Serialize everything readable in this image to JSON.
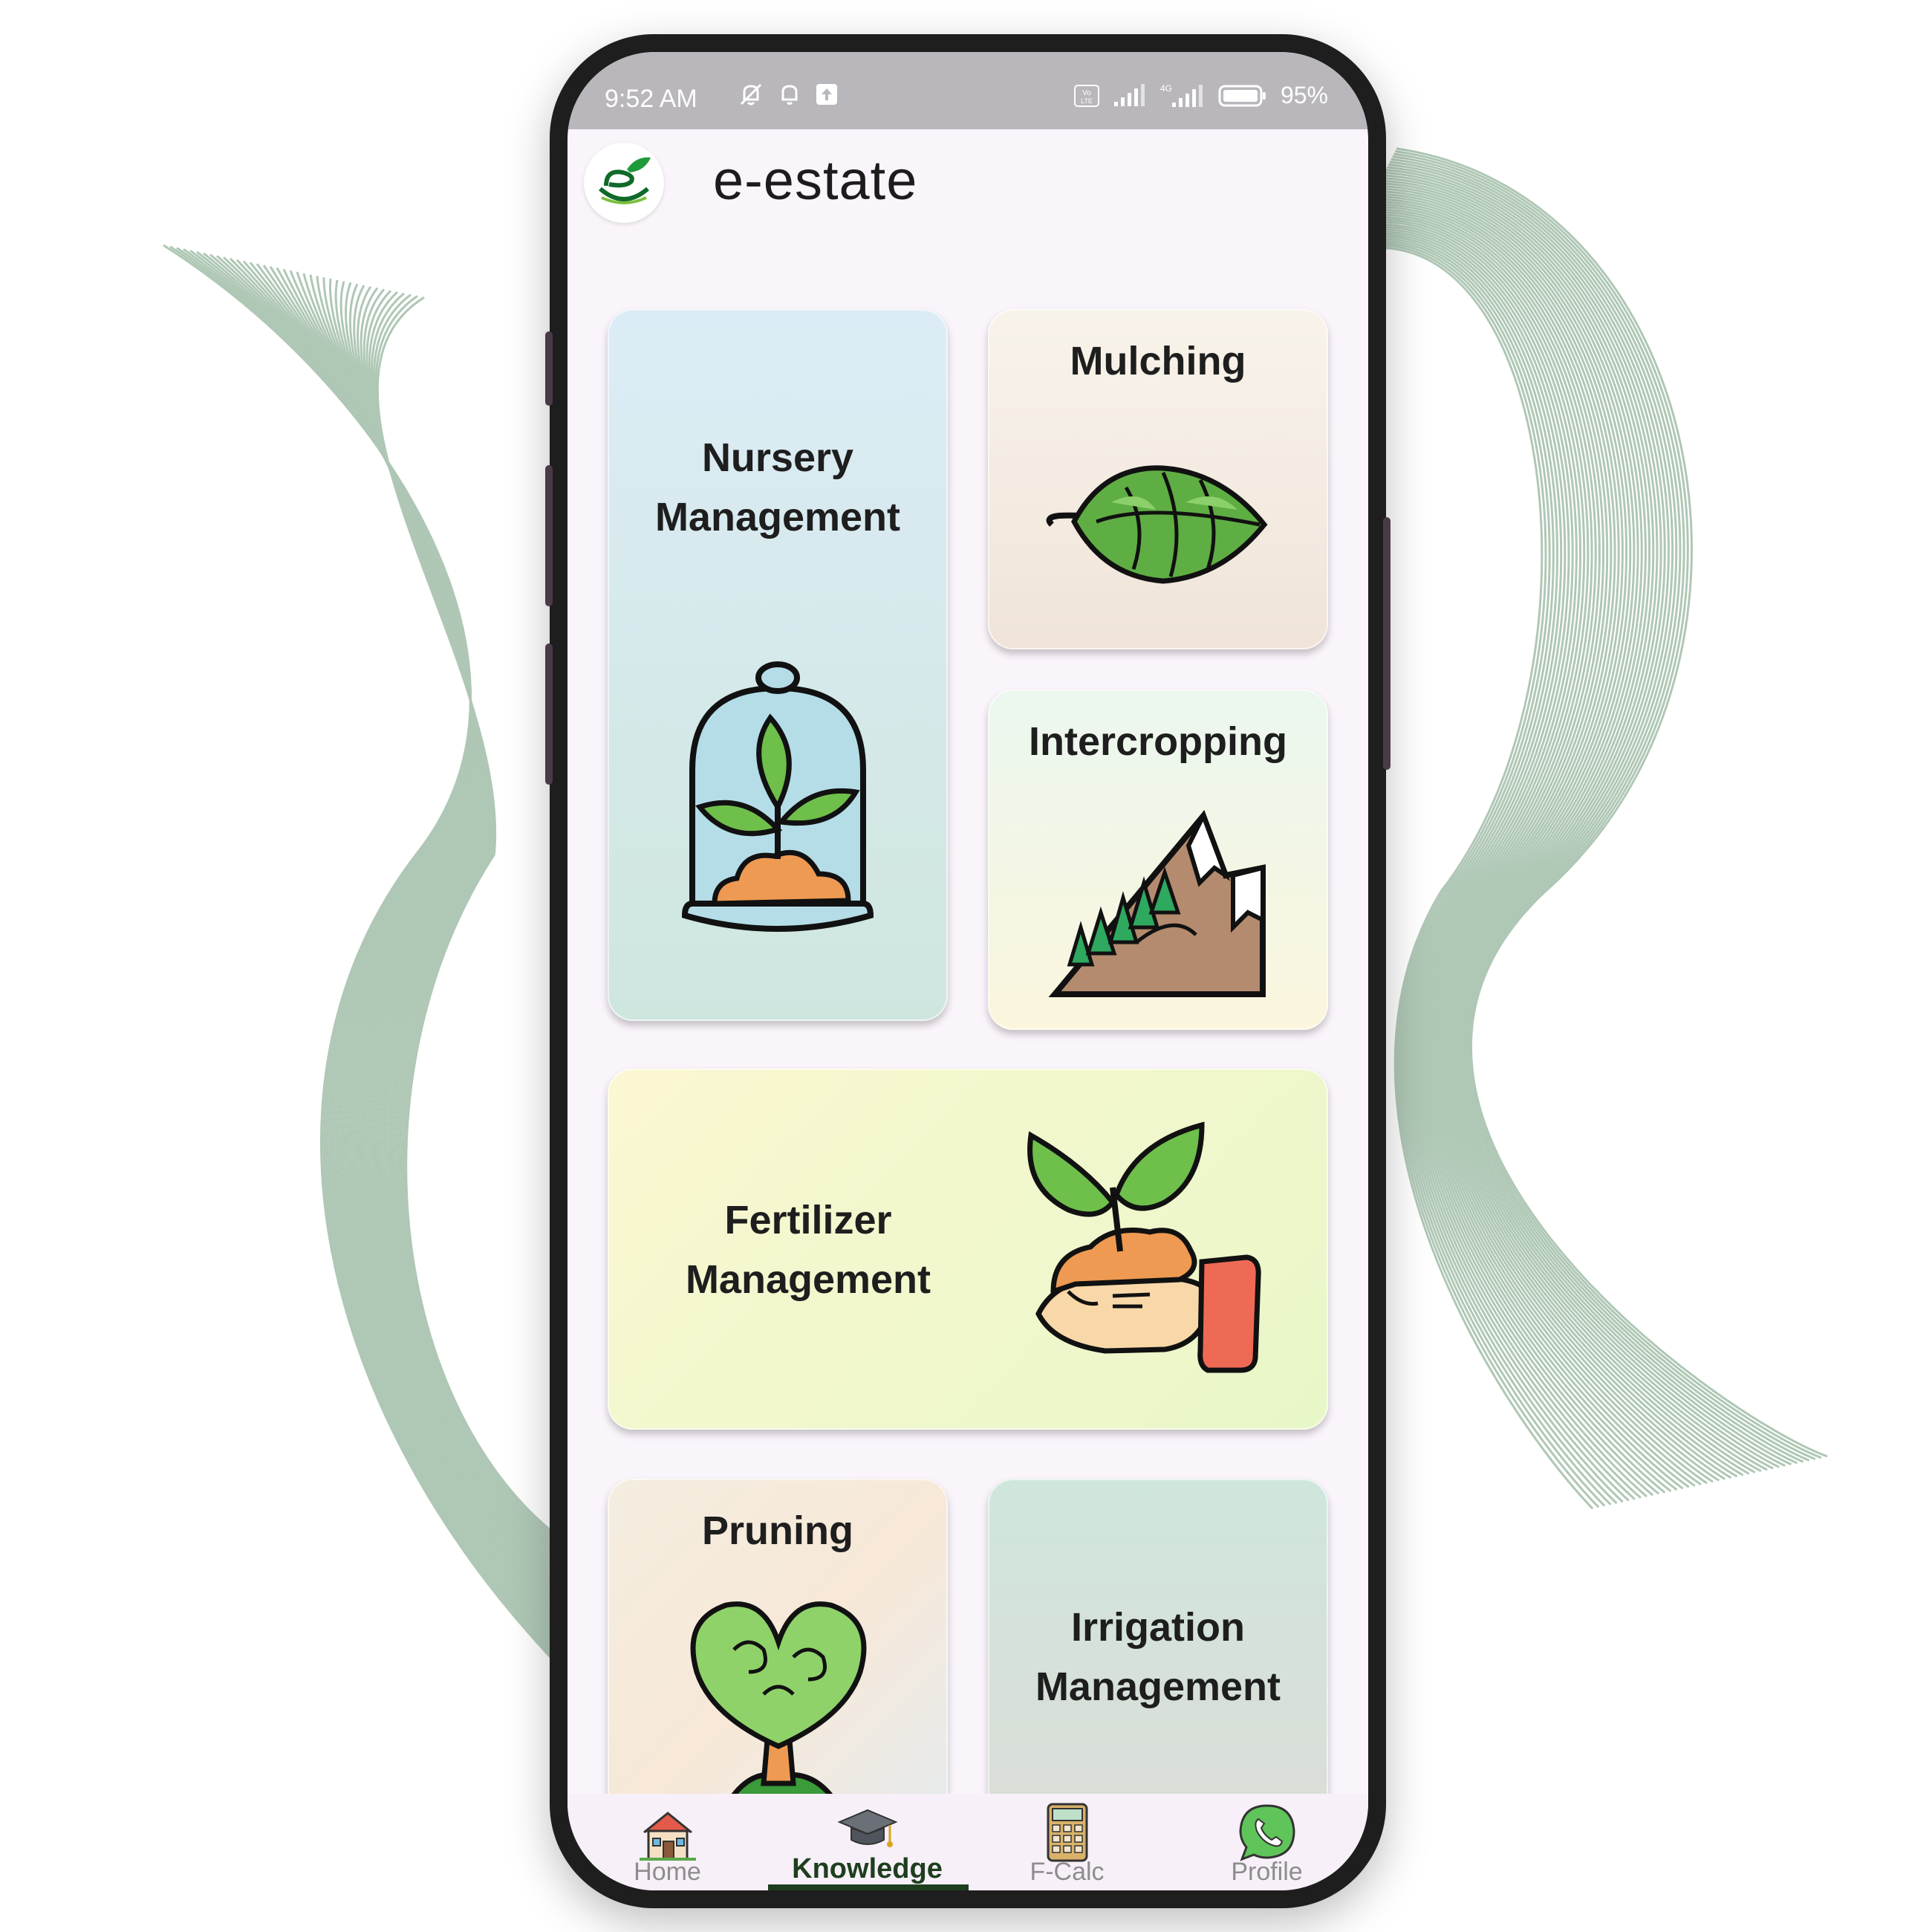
{
  "status_bar": {
    "time": "9:52 AM",
    "battery": "95%",
    "icons_left": [
      "mute-icon",
      "bell-icon",
      "upload-icon"
    ],
    "icons_right": [
      "volte-icon",
      "signal-icon",
      "4g-signal-icon",
      "battery-icon"
    ]
  },
  "app": {
    "title": "e-estate",
    "logo": "e-estate-logo"
  },
  "cards": [
    {
      "label": "Nursery Management",
      "line1": "Nursery",
      "line2": "Management",
      "icon": "seedling-jar-icon"
    },
    {
      "label": "Mulching",
      "icon": "leaf-pile-icon"
    },
    {
      "label": "Intercropping",
      "icon": "mountain-trees-icon"
    },
    {
      "label": "Fertilizer Management",
      "line1": "Fertilizer",
      "line2": "Management",
      "icon": "hand-soil-plant-icon"
    },
    {
      "label": "Pruning",
      "icon": "heart-tree-icon"
    },
    {
      "label": "Irrigation Management",
      "line1": "Irrigation",
      "line2": "Management"
    }
  ],
  "bottom_nav": {
    "items": [
      {
        "label": "Home",
        "icon": "home-icon",
        "active": false
      },
      {
        "label": "Knowledge",
        "icon": "graduation-cap-icon",
        "active": true
      },
      {
        "label": "F-Calc",
        "icon": "calculator-icon",
        "active": false
      },
      {
        "label": "Profile",
        "icon": "whatsapp-profile-icon",
        "active": false
      }
    ]
  },
  "colors": {
    "accent": "#1e3e1e",
    "status_bar": "#b9b6bc",
    "screen_bg": "#faf4fb"
  }
}
